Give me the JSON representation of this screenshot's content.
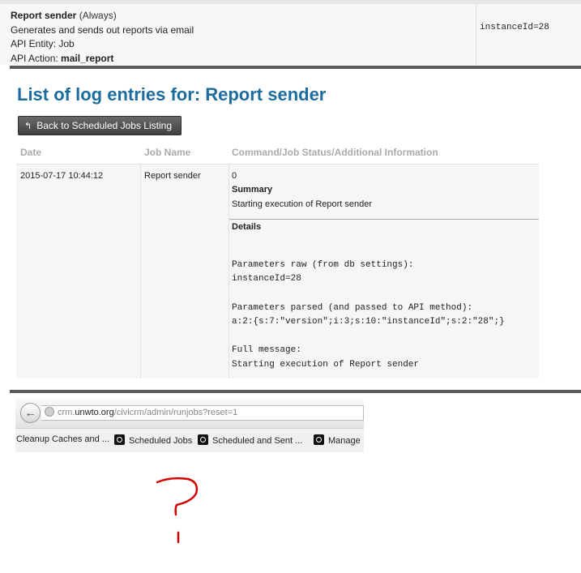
{
  "job": {
    "name": "Report sender",
    "frequency": "(Always)",
    "description": "Generates and sends out reports via email",
    "api_entity_label": "API Entity:",
    "api_entity": "Job",
    "api_action_label": "API Action:",
    "api_action": "mail_report",
    "parameters": "instanceId=28"
  },
  "page": {
    "title": "List of log entries for: Report sender",
    "back_label": "Back to Scheduled Jobs Listing"
  },
  "log_table": {
    "headers": [
      "Date",
      "Job Name",
      "Command/Job Status/Additional Information"
    ],
    "rows": [
      {
        "date": "2015-07-17 10:44:12",
        "job_name": "Report sender",
        "status_code": "0",
        "summary_label": "Summary",
        "summary": "Starting execution of Report sender",
        "details_label": "Details",
        "params_raw_label": "Parameters raw (from db settings):",
        "params_raw": "instanceId=28",
        "params_parsed_label": "Parameters parsed (and passed to API method):",
        "params_parsed": "a:2:{s:7:\"version\";i:3;s:10:\"instanceId\";s:2:\"28\";}",
        "full_message_label": "Full message:",
        "full_message": "Starting execution of Report sender"
      }
    ]
  },
  "browser": {
    "url_domain_prefix": "crm.",
    "url_domain": "unwto.org",
    "url_path": "/civicrm/admin/runjobs?reset=1",
    "bookmarks": [
      "Cleanup Caches and ...",
      "Scheduled Jobs",
      "Scheduled and Sent ...",
      "Manage"
    ]
  },
  "annotation_color": "#d40000"
}
